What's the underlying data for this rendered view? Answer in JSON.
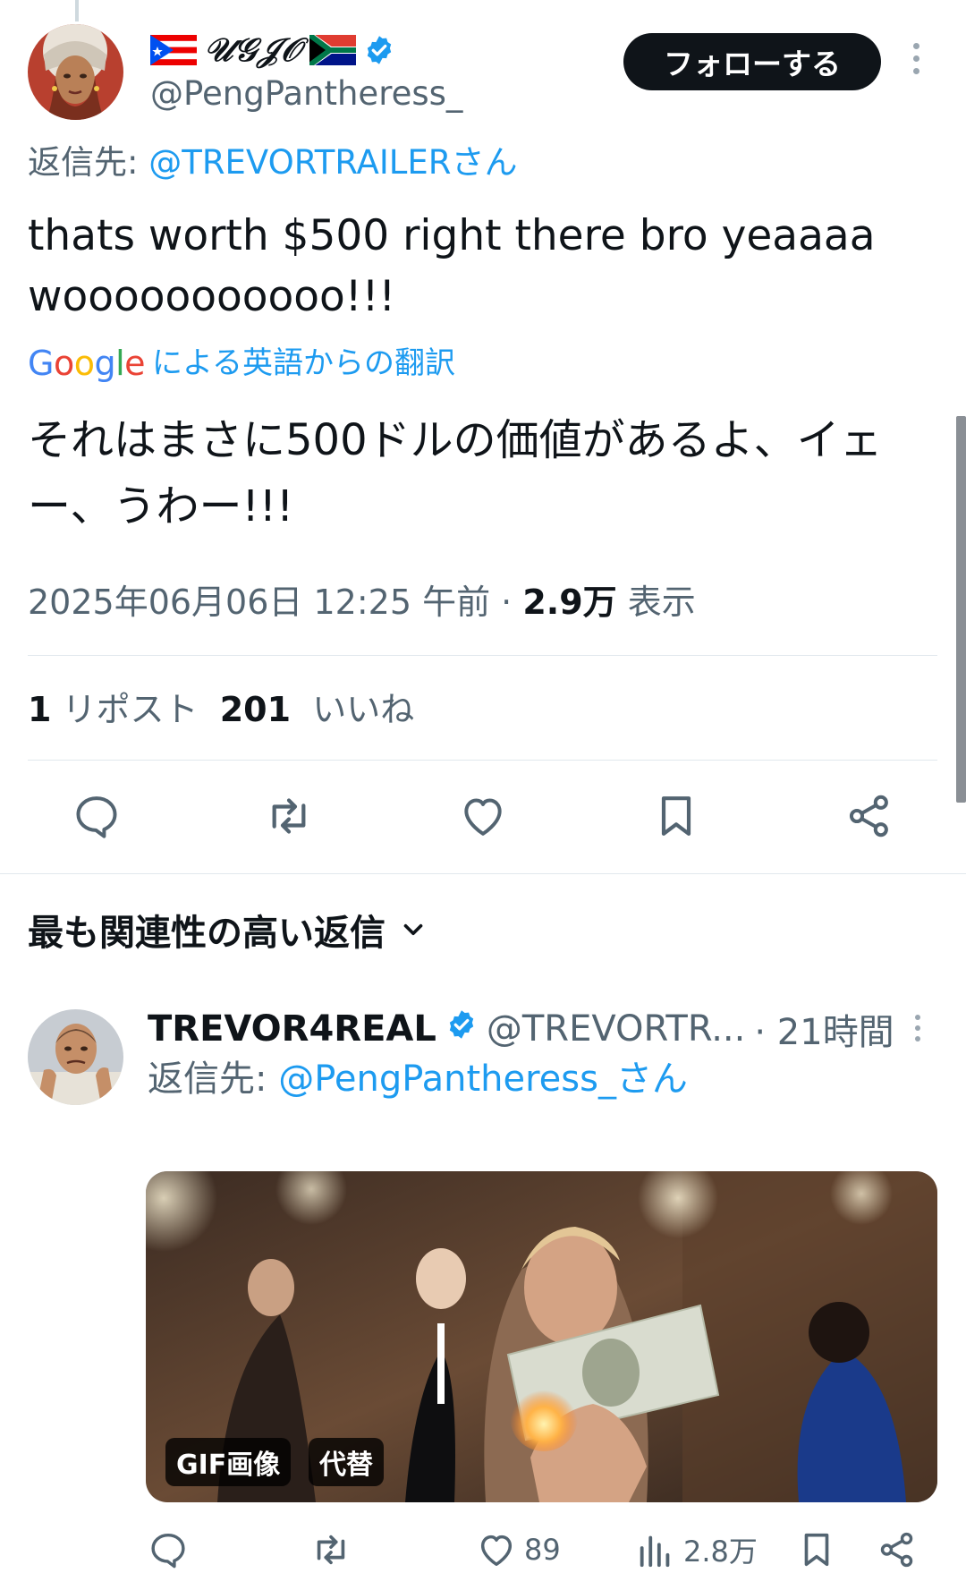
{
  "main_tweet": {
    "display_name": "𝒰𝒢𝒥𝒪",
    "handle": "@PengPantheress_",
    "follow_label": "フォローする",
    "reply_to_prefix": "返信先: ",
    "reply_to_mention": "@TREVORTRAILERさん",
    "text": "thats worth $500 right there bro yeaaaa wooooooooooo!!!",
    "translation_label": "による英語からの翻訳",
    "translated_text": "それはまさに500ドルの価値があるよ、イェー、うわー!!!",
    "timestamp": "2025年06月06日 12:25 午前 · ",
    "views_count": "2.9万",
    "views_label": " 表示",
    "repost_count": "1",
    "repost_label": " リポスト ",
    "like_count": "201",
    "like_label": " いいね"
  },
  "google_logo": [
    "G",
    "o",
    "o",
    "g",
    "l",
    "e"
  ],
  "replies_sort_label": "最も関連性の高い返信",
  "reply_tweet": {
    "display_name": "TREVOR4REAL",
    "handle": "@TREVORTR...",
    "time": "· 21時間",
    "reply_to_prefix": "返信先: ",
    "reply_to_mention": "@PengPantheress_さん",
    "gif_badge": "GIF画像",
    "alt_badge": "代替",
    "like_count": "89",
    "views_count": "2.8万"
  },
  "icons": {
    "main_actions": [
      "reply-icon",
      "retweet-icon",
      "like-icon",
      "bookmark-icon",
      "share-icon"
    ],
    "reply_actions": [
      "reply-icon",
      "retweet-icon",
      "like-icon",
      "views-icon",
      "bookmark-icon",
      "share-icon"
    ]
  },
  "colors": {
    "accent": "#1d9bf0",
    "text_primary": "#0f1419",
    "text_secondary": "#536471",
    "follow_bg": "#0f1419",
    "verified": "#1d9bf0"
  }
}
